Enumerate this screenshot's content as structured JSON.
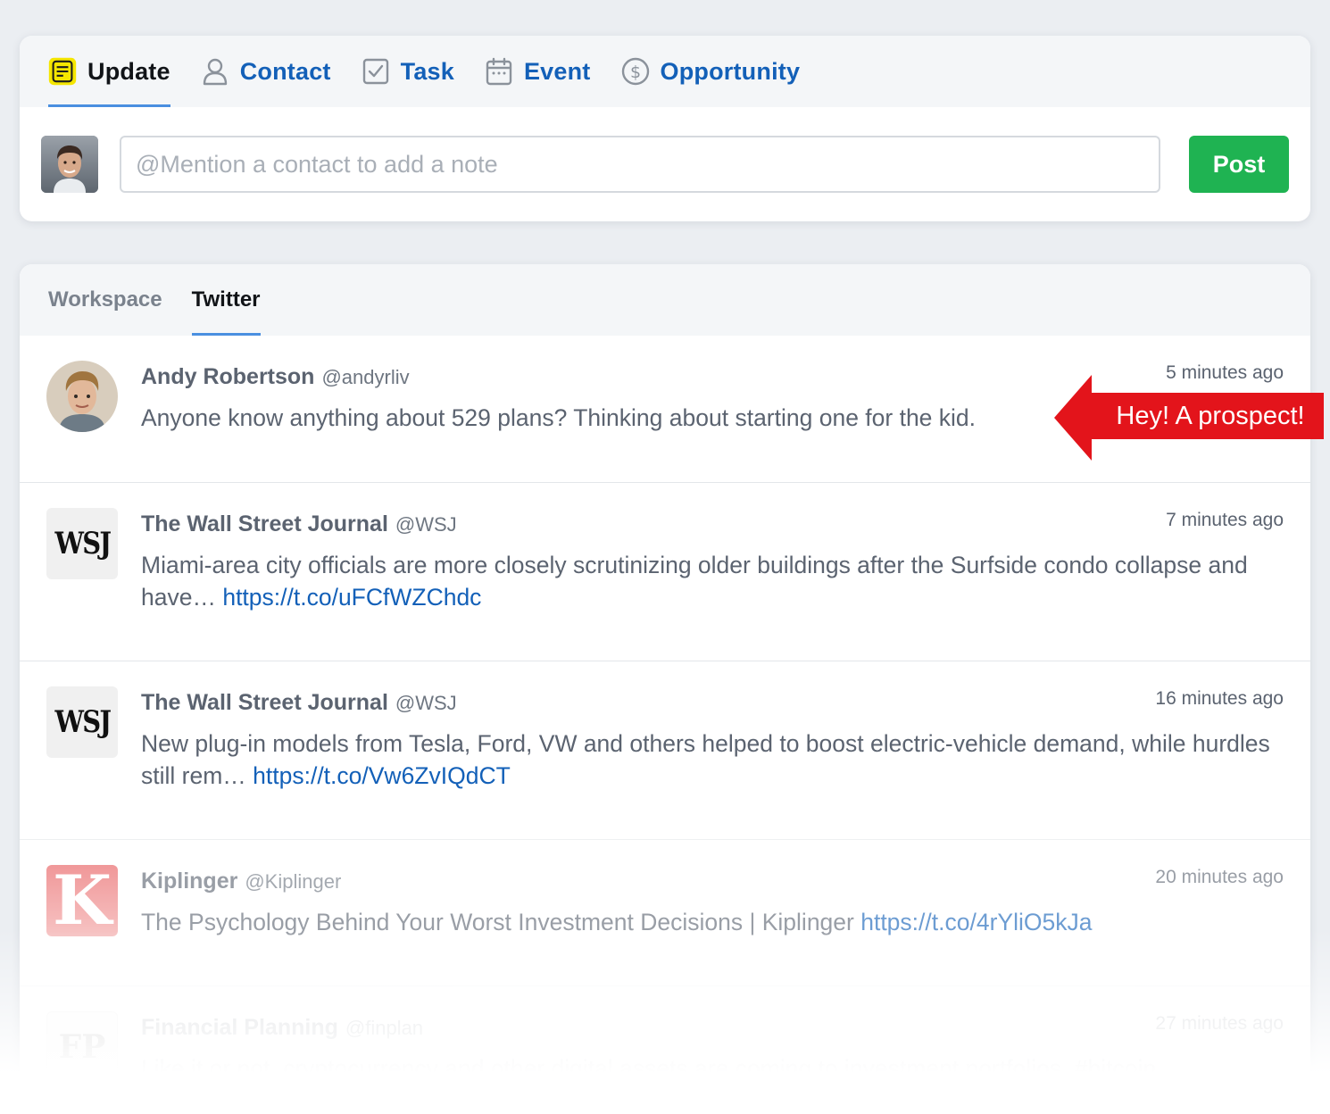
{
  "composer": {
    "tabs": [
      {
        "label": "Update",
        "icon": "note-icon"
      },
      {
        "label": "Contact",
        "icon": "person-icon"
      },
      {
        "label": "Task",
        "icon": "checkbox-icon"
      },
      {
        "label": "Event",
        "icon": "calendar-icon"
      },
      {
        "label": "Opportunity",
        "icon": "dollar-circle-icon"
      }
    ],
    "active_tab": "Update",
    "note_placeholder": "@Mention a contact to add a note",
    "note_value": "",
    "post_label": "Post"
  },
  "feed": {
    "tabs": [
      {
        "label": "Workspace"
      },
      {
        "label": "Twitter"
      }
    ],
    "active_tab": "Twitter",
    "tweets": [
      {
        "name": "Andy Robertson",
        "handle": "@andyrliv",
        "time": "5 minutes ago",
        "text": "Anyone know anything about 529 plans? Thinking about starting one for the kid.",
        "link": ""
      },
      {
        "name": "The Wall Street Journal",
        "handle": "@WSJ",
        "avatar_text": "WSJ",
        "time": "7 minutes ago",
        "text": "Miami-area city officials are more closely scrutinizing older buildings after the Surfside condo collapse and have… ",
        "link": "https://t.co/uFCfWZChdc"
      },
      {
        "name": "The Wall Street Journal",
        "handle": "@WSJ",
        "avatar_text": "WSJ",
        "time": "16 minutes ago",
        "text": "New plug-in models from Tesla, Ford, VW and others helped to boost electric-vehicle demand, while hurdles still rem… ",
        "link": "https://t.co/Vw6ZvIQdCT"
      },
      {
        "name": "Kiplinger",
        "handle": "@Kiplinger",
        "avatar_text": "K",
        "time": "20 minutes ago",
        "text": "The Psychology Behind Your Worst Investment Decisions | Kiplinger ",
        "link": "https://t.co/4rYliO5kJa"
      },
      {
        "name": "Financial Planning",
        "handle": "@finplan",
        "avatar_text": "FP",
        "time": "27 minutes ago",
        "text": "Like it or not, cryptocurrency and other digital assets are coming to investment portfolios. #bitcoin",
        "link": ""
      }
    ]
  },
  "callout": {
    "text": "Hey! A prospect!",
    "color": "#e3141b"
  },
  "colors": {
    "link": "#1360b8",
    "post_button": "#1fb352",
    "active_underline": "#4a8fe0",
    "update_icon": "#f5e600"
  }
}
